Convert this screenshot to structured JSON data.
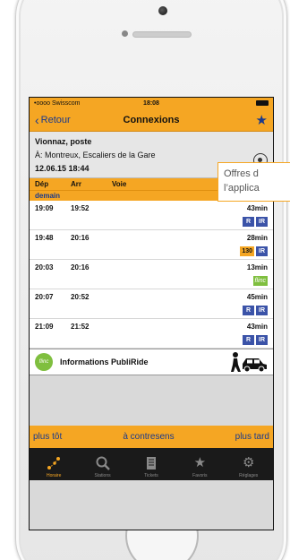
{
  "status_bar": {
    "carrier": "•oooo Swisscom",
    "time": "18:08"
  },
  "nav": {
    "back_label": "Retour",
    "title": "Connexions"
  },
  "info": {
    "from": "Vionnaz, poste",
    "to": "À: Montreux, Escaliers de la Gare",
    "datetime": "12.06.15 18:44"
  },
  "table_header": {
    "dep": "Dép",
    "arr": "Arr",
    "voie": "Voie"
  },
  "day_label": "demain",
  "connections": [
    {
      "dep": "19:09",
      "arr": "19:52",
      "duration": "43min",
      "badges": [
        "R",
        "IR"
      ]
    },
    {
      "dep": "19:48",
      "arr": "20:16",
      "duration": "28min",
      "badges": [
        "130",
        "IR"
      ]
    },
    {
      "dep": "20:03",
      "arr": "20:16",
      "duration": "13min",
      "badges": [
        "flinc"
      ]
    },
    {
      "dep": "20:07",
      "arr": "20:52",
      "duration": "45min",
      "badges": [
        "R",
        "IR"
      ]
    },
    {
      "dep": "21:09",
      "arr": "21:52",
      "duration": "43min",
      "badges": [
        "R",
        "IR"
      ]
    }
  ],
  "publiride": {
    "logo_text": "flinc",
    "label": "Informations PubliRide"
  },
  "actions": {
    "earlier": "plus tôt",
    "reverse": "à contresens",
    "later": "plus tard"
  },
  "tabs": [
    {
      "label": "Horaire",
      "icon": "route-icon"
    },
    {
      "label": "Stations",
      "icon": "search-icon"
    },
    {
      "label": "Tickets",
      "icon": "ticket-icon"
    },
    {
      "label": "Favoris",
      "icon": "star-icon"
    },
    {
      "label": "Réglages",
      "icon": "gear-icon"
    }
  ],
  "callout": {
    "line1": "Offres d",
    "line2": "l’applica"
  },
  "colors": {
    "accent": "#f5a623",
    "link": "#1a3a8c",
    "badge_blue": "#3b53a8",
    "badge_green": "#7fbf3f"
  }
}
